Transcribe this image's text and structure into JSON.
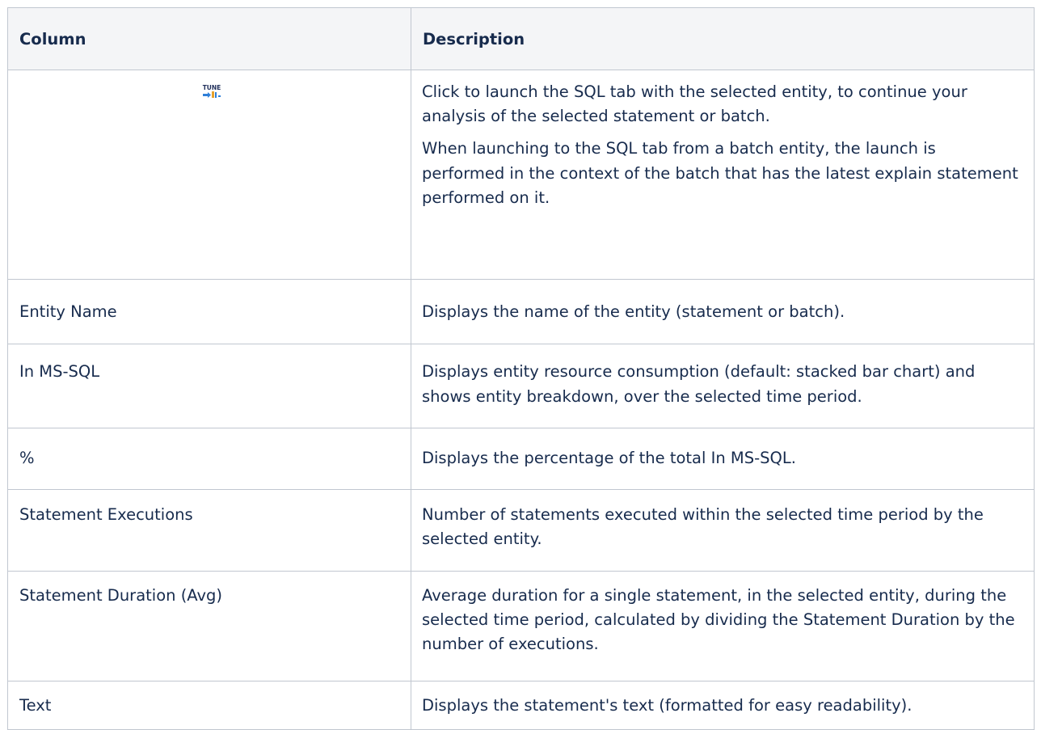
{
  "table": {
    "headers": {
      "column": "Column",
      "description": "Description"
    },
    "rows": [
      {
        "column_icon": "tune-icon",
        "icon_text": "TUNE",
        "description": [
          "Click to launch the SQL tab with the selected entity, to continue your analysis of the selected statement or batch.",
          "When launching to the SQL tab from a batch entity, the launch is performed in the context of the batch that has the latest explain statement performed on it."
        ]
      },
      {
        "column": "Entity Name",
        "description": "Displays the name of the entity (statement or batch)."
      },
      {
        "column": "In MS-SQL",
        "description": "Displays entity resource consumption (default: stacked bar chart) and shows entity breakdown, over the selected time period."
      },
      {
        "column": "%",
        "description": "Displays the percentage of the total In MS-SQL."
      },
      {
        "column": "Statement Executions",
        "description": "Number of statements executed within the selected time period by the selected entity."
      },
      {
        "column": "Statement Duration (Avg)",
        "description": "Average duration for a single statement, in the selected entity, during the selected time period, calculated by dividing the Statement Duration by the number of executions."
      },
      {
        "column": "Text",
        "description": "Displays the statement's text (formatted for easy readability)."
      }
    ]
  },
  "colors": {
    "text": "#172b4d",
    "header_bg": "#f4f5f7",
    "border": "#c1c7d0"
  }
}
